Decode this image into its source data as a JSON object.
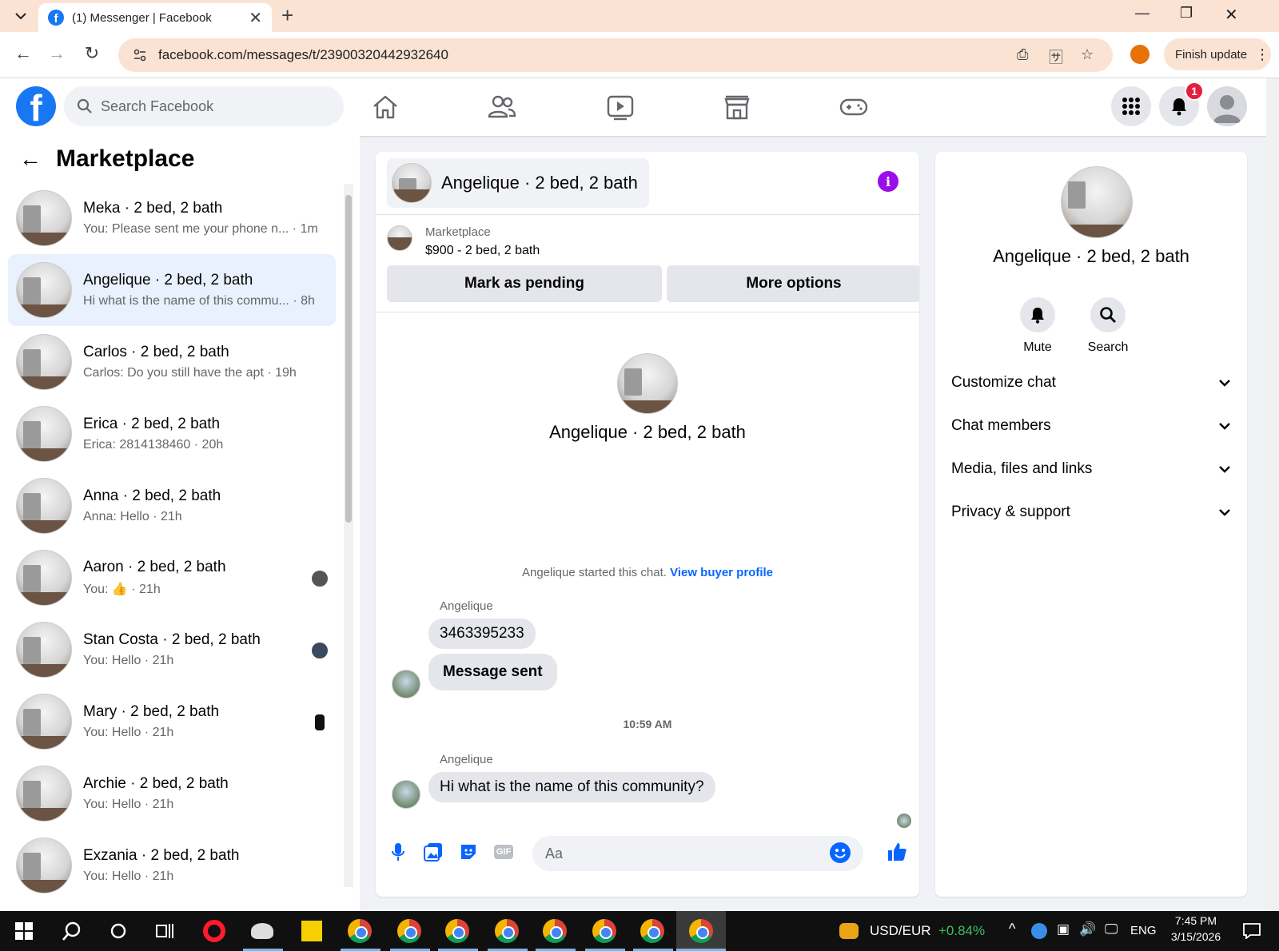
{
  "browser": {
    "tab_title": "(1) Messenger | Facebook",
    "url": "facebook.com/messages/t/23900320442932640",
    "finish_update": "Finish update"
  },
  "fb": {
    "search_placeholder": "Search Facebook",
    "notif_count": "1"
  },
  "sidebar": {
    "title": "Marketplace",
    "conversations": [
      {
        "name": "Meka · 2 bed, 2 bath",
        "preview": "You: Please sent me your phone n... · 1m"
      },
      {
        "name": "Angelique · 2 bed, 2 bath",
        "preview": "Hi what is the name of this commu... · 8h"
      },
      {
        "name": "Carlos · 2 bed, 2 bath",
        "preview": "Carlos: Do you still have the apt · 19h"
      },
      {
        "name": "Erica · 2 bed, 2 bath",
        "preview": "Erica: 2814138460 · 20h"
      },
      {
        "name": "Anna · 2 bed, 2 bath",
        "preview": "Anna: Hello · 21h"
      },
      {
        "name": "Aaron · 2 bed, 2 bath",
        "preview": "You: 👍 · 21h"
      },
      {
        "name": "Stan Costa · 2 bed, 2 bath",
        "preview": "You: Hello · 21h"
      },
      {
        "name": "Mary · 2 bed, 2 bath",
        "preview": "You: Hello · 21h"
      },
      {
        "name": "Archie · 2 bed, 2 bath",
        "preview": "You: Hello · 21h"
      },
      {
        "name": "Exzania · 2 bed, 2 bath",
        "preview": "You: Hello · 21h"
      }
    ]
  },
  "chat": {
    "header_name": "Angelique · 2 bed, 2 bath",
    "listing_label": "Marketplace",
    "listing_detail": "$900 - 2 bed, 2 bath",
    "mark_pending": "Mark as pending",
    "more_options": "More options",
    "hero_name": "Angelique · 2 bed, 2 bath",
    "started_text": "Angelique started this chat.",
    "view_buyer": "View buyer profile",
    "messages": [
      {
        "sender": "Angelique",
        "text": "3463395233"
      },
      {
        "text": "Message sent"
      },
      {
        "sender": "Angelique",
        "text": "Hi what is the name of this community?"
      }
    ],
    "timestamp": "10:59 AM",
    "input_placeholder": "Aa",
    "gif_label": "GIF"
  },
  "info": {
    "name": "Angelique · 2 bed, 2 bath",
    "mute": "Mute",
    "search": "Search",
    "sections": [
      "Customize chat",
      "Chat members",
      "Media, files and links",
      "Privacy & support"
    ]
  },
  "taskbar": {
    "ticker": "USD/EUR",
    "ticker_change": "+0.84%",
    "lang": "ENG",
    "time": "7:45 PM",
    "date": "3/15/2026"
  },
  "colors": {
    "fb_blue": "#1877f2",
    "messenger_blue": "#0866ff",
    "info_purple": "#9b0de8",
    "ticker_green": "#3fbf5f"
  }
}
